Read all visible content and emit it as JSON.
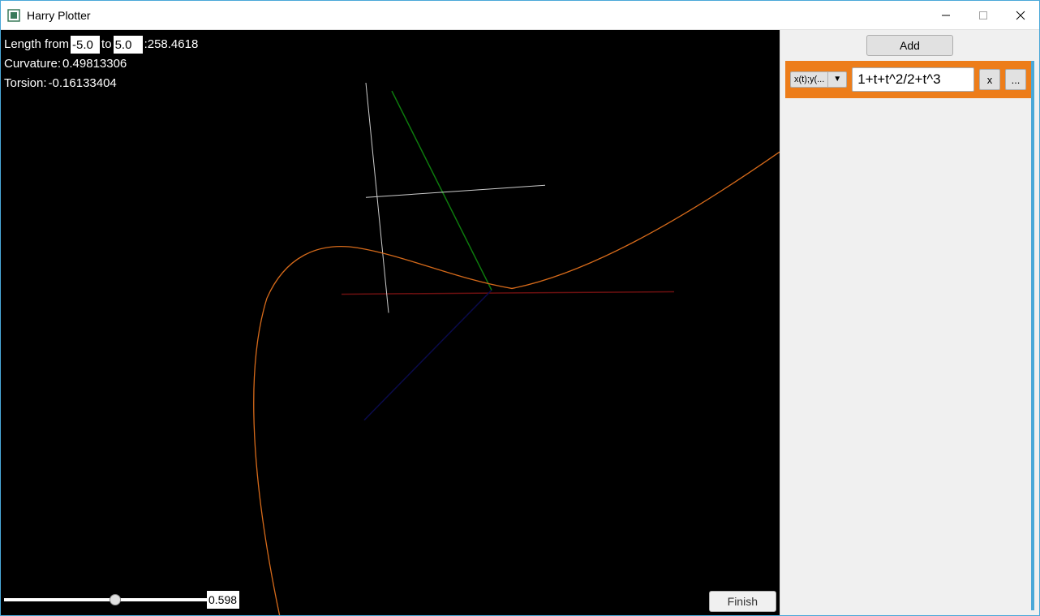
{
  "window": {
    "title": "Harry Plotter"
  },
  "info": {
    "length_label_from": "Length from",
    "length_from": "-5.0",
    "length_label_to": "to",
    "length_to": "5.0",
    "length_result": ":258.4618",
    "curvature_label": "Curvature:",
    "curvature_value": "0.49813306",
    "torsion_label": "Torsion:",
    "torsion_value": "-0.16133404"
  },
  "slider": {
    "value": "0.598"
  },
  "buttons": {
    "finish": "Finish",
    "add": "Add",
    "remove": "x",
    "more": "..."
  },
  "functions": [
    {
      "type_label": "x(t);y(...",
      "formula": "1+t+t^2/2+t^3"
    }
  ]
}
